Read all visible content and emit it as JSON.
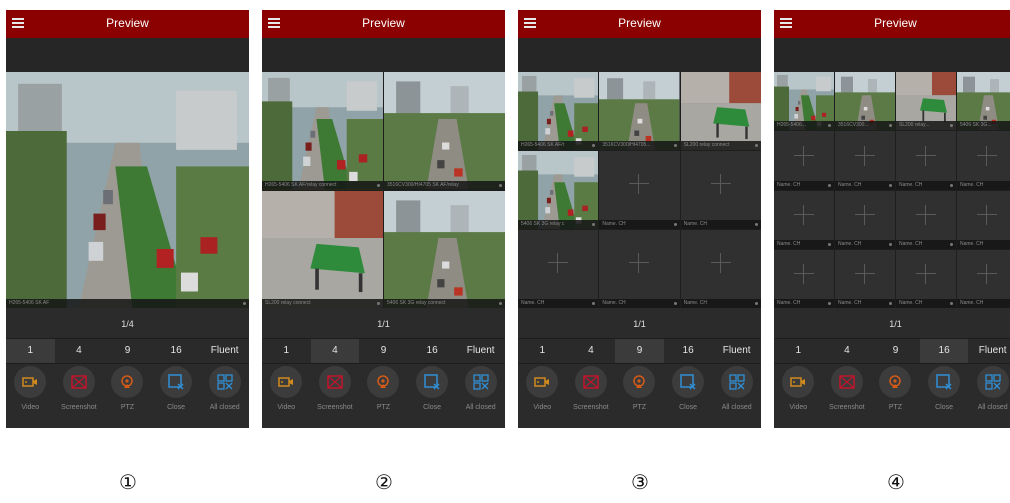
{
  "colors": {
    "titlebar": "#8b0000",
    "selection": "#d7b600",
    "video_icon": "#d08a1e",
    "screenshot_icon": "#c0152b",
    "ptz_icon": "#d55a18",
    "close_icon": "#2f8fd6",
    "allclosed_icon": "#2f8fd6"
  },
  "screens": [
    {
      "title": "Preview",
      "page_indicator": "1/4",
      "active_tab": 0,
      "tabs": [
        "1",
        "4",
        "9",
        "16",
        "Fluent"
      ],
      "actions": [
        {
          "label": "Video",
          "icon": "video-camera-icon"
        },
        {
          "label": "Screenshot",
          "icon": "screenshot-icon"
        },
        {
          "label": "PTZ",
          "icon": "ptz-icon"
        },
        {
          "label": "Close",
          "icon": "close-window-icon"
        },
        {
          "label": "All closed",
          "icon": "all-closed-icon"
        }
      ],
      "cells": [
        {
          "scene": "street",
          "label": "H265-5406 SK AF"
        }
      ]
    },
    {
      "title": "Preview",
      "page_indicator": "1/1",
      "active_tab": 1,
      "tabs": [
        "1",
        "4",
        "9",
        "16",
        "Fluent"
      ],
      "actions": [
        {
          "label": "Video",
          "icon": "video-camera-icon"
        },
        {
          "label": "Screenshot",
          "icon": "screenshot-icon"
        },
        {
          "label": "PTZ",
          "icon": "ptz-icon"
        },
        {
          "label": "Close",
          "icon": "close-window-icon"
        },
        {
          "label": "All closed",
          "icon": "all-closed-icon"
        }
      ],
      "cells": [
        {
          "scene": "street",
          "label": "H265-5406 SK AF/relay connect"
        },
        {
          "scene": "street2",
          "label": "3516CV300/HI4705 SK AF/relay"
        },
        {
          "scene": "room",
          "label": "SL200 relay connect"
        },
        {
          "scene": "street2",
          "label": "5406 SK 3G relay connect"
        }
      ]
    },
    {
      "title": "Preview",
      "page_indicator": "1/1",
      "active_tab": 2,
      "tabs": [
        "1",
        "4",
        "9",
        "16",
        "Fluent"
      ],
      "actions": [
        {
          "label": "Video",
          "icon": "video-camera-icon"
        },
        {
          "label": "Screenshot",
          "icon": "screenshot-icon"
        },
        {
          "label": "PTZ",
          "icon": "ptz-icon"
        },
        {
          "label": "Close",
          "icon": "close-window-icon"
        },
        {
          "label": "All closed",
          "icon": "all-closed-icon"
        }
      ],
      "cells": [
        {
          "scene": "street",
          "label": "H265-5406 SK AF/r"
        },
        {
          "scene": "street2",
          "label": "3516CV300/HI4705..."
        },
        {
          "scene": "room",
          "label": "SL200 relay connect"
        },
        {
          "scene": "street",
          "label": "5406 SK 3G relay c"
        },
        {
          "scene": "empty",
          "label": "Name. CH"
        },
        {
          "scene": "empty",
          "label": "Name. CH"
        },
        {
          "scene": "empty",
          "label": "Name. CH"
        },
        {
          "scene": "empty",
          "label": "Name. CH"
        },
        {
          "scene": "empty",
          "label": "Name. CH"
        }
      ]
    },
    {
      "title": "Preview",
      "page_indicator": "1/1",
      "active_tab": 3,
      "tabs": [
        "1",
        "4",
        "9",
        "16",
        "Fluent"
      ],
      "actions": [
        {
          "label": "Video",
          "icon": "video-camera-icon"
        },
        {
          "label": "Screenshot",
          "icon": "screenshot-icon"
        },
        {
          "label": "PTZ",
          "icon": "ptz-icon"
        },
        {
          "label": "Close",
          "icon": "close-window-icon"
        },
        {
          "label": "All closed",
          "icon": "all-closed-icon"
        }
      ],
      "cells": [
        {
          "scene": "street",
          "label": "H265-5406..."
        },
        {
          "scene": "street2",
          "label": "3516CV300..."
        },
        {
          "scene": "room",
          "label": "SL200 relay..."
        },
        {
          "scene": "street2",
          "label": "5406 SK 3G..."
        },
        {
          "scene": "empty",
          "label": "Name. CH"
        },
        {
          "scene": "empty",
          "label": "Name. CH"
        },
        {
          "scene": "empty",
          "label": "Name. CH"
        },
        {
          "scene": "empty",
          "label": "Name. CH"
        },
        {
          "scene": "empty",
          "label": "Name. CH"
        },
        {
          "scene": "empty",
          "label": "Name. CH"
        },
        {
          "scene": "empty",
          "label": "Name. CH"
        },
        {
          "scene": "empty",
          "label": "Name. CH"
        },
        {
          "scene": "empty",
          "label": "Name. CH"
        },
        {
          "scene": "empty",
          "label": "Name. CH"
        },
        {
          "scene": "empty",
          "label": "Name. CH"
        },
        {
          "scene": "empty",
          "label": "Name. CH"
        }
      ]
    }
  ],
  "step_numbers": [
    "①",
    "②",
    "③",
    "④"
  ]
}
